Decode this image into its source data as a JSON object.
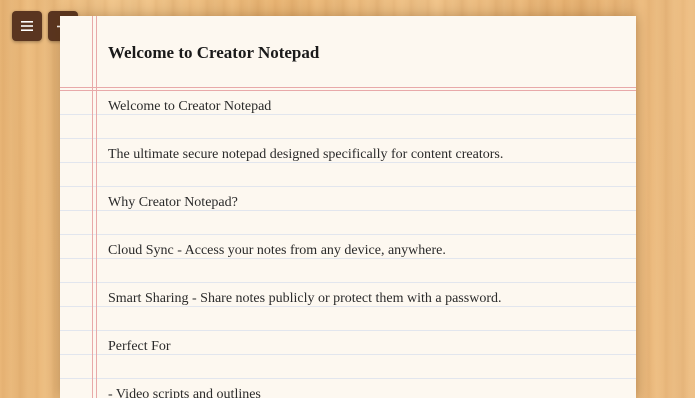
{
  "toolbar": {
    "menu_icon": "menu-icon",
    "add_icon": "plus-icon"
  },
  "note": {
    "title": "Welcome to Creator Notepad",
    "lines": [
      "Welcome to Creator Notepad",
      "",
      "The ultimate secure notepad designed specifically for content creators.",
      "",
      "Why Creator Notepad?",
      "",
      "Cloud Sync - Access your notes from any device, anywhere.",
      "",
      "Smart Sharing - Share notes publicly or protect them with a password.",
      "",
      "Perfect For",
      "",
      "- Video scripts and outlines"
    ]
  },
  "colors": {
    "button_bg": "#5a3520",
    "paper_bg": "#fdf8f0",
    "margin_line": "#e8a9a9",
    "rule_line": "#e2e6ee"
  }
}
